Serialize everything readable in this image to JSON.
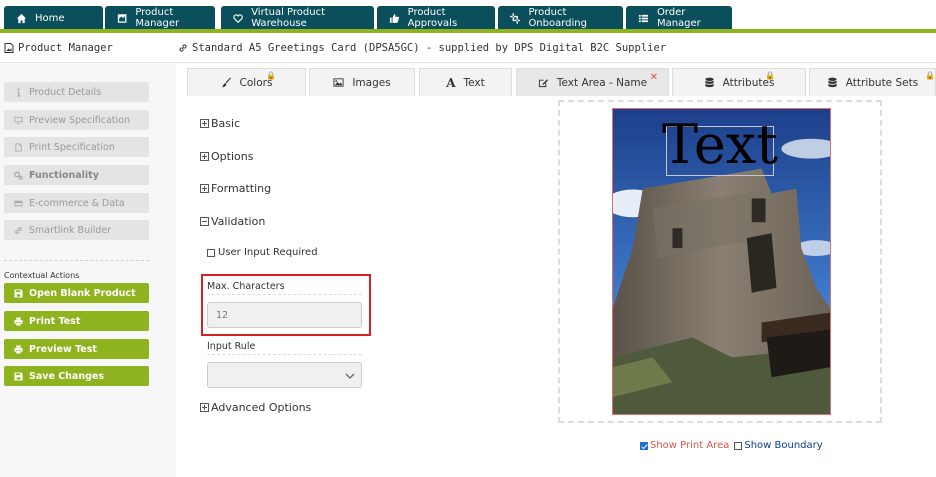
{
  "topnav": {
    "tabs": [
      {
        "label": "Home",
        "icon": "home-icon"
      },
      {
        "label": "Product Manager",
        "icon": "product-manager-icon"
      },
      {
        "label": "Virtual Product Warehouse",
        "icon": "heart-icon"
      },
      {
        "label": "Product Approvals",
        "icon": "thumbs-up-icon"
      },
      {
        "label": "Product Onboarding",
        "icon": "crop-icon"
      },
      {
        "label": "Order Manager",
        "icon": "list-icon"
      }
    ]
  },
  "header": {
    "section_title": "Product Manager",
    "product_title": "Standard A5 Greetings Card (DPSA5GC) - supplied by DPS Digital B2C Supplier"
  },
  "sidebar": {
    "items": [
      {
        "label": "Product Details",
        "icon": "info-icon"
      },
      {
        "label": "Preview Specification",
        "icon": "monitor-icon"
      },
      {
        "label": "Print Specification",
        "icon": "file-icon"
      },
      {
        "label": "Functionality",
        "icon": "cogs-icon"
      },
      {
        "label": "E-commerce & Data",
        "icon": "credit-card-icon"
      },
      {
        "label": "Smartlink Builder",
        "icon": "link-icon"
      }
    ],
    "context_label": "Contextual Actions",
    "actions": [
      {
        "label": "Open Blank Product",
        "icon": "save-icon"
      },
      {
        "label": "Print Test",
        "icon": "print-icon"
      },
      {
        "label": "Preview Test",
        "icon": "print-icon"
      },
      {
        "label": "Save Changes",
        "icon": "save-icon"
      }
    ]
  },
  "content_tabs": [
    {
      "label": "Colors",
      "icon": "brush-icon",
      "locked": true
    },
    {
      "label": "Images",
      "icon": "image-icon",
      "locked": false
    },
    {
      "label": "Text",
      "icon": "font-icon",
      "locked": false
    },
    {
      "label": "Text Area - Name",
      "icon": "edit-icon",
      "closable": true
    },
    {
      "label": "Attributes",
      "icon": "database-icon",
      "locked": true
    },
    {
      "label": "Attribute Sets",
      "icon": "database-icon",
      "locked": true
    }
  ],
  "accordion": {
    "basic": "Basic",
    "options": "Options",
    "formatting": "Formatting",
    "validation": "Validation",
    "advanced": "Advanced Options"
  },
  "validation": {
    "user_input_required": "User Input Required",
    "max_chars_label": "Max. Characters",
    "max_chars_value": "12",
    "input_rule_label": "Input Rule",
    "input_rule_value": ""
  },
  "preview": {
    "overlay_text": "Text",
    "show_print_area": "Show Print Area",
    "show_boundary": "Show Boundary",
    "show_print_area_checked": true,
    "show_boundary_checked": false
  },
  "colors": {
    "nav_bg": "#0b4f5c",
    "accent_green": "#8fb31e",
    "highlight_red": "#d81f26"
  }
}
